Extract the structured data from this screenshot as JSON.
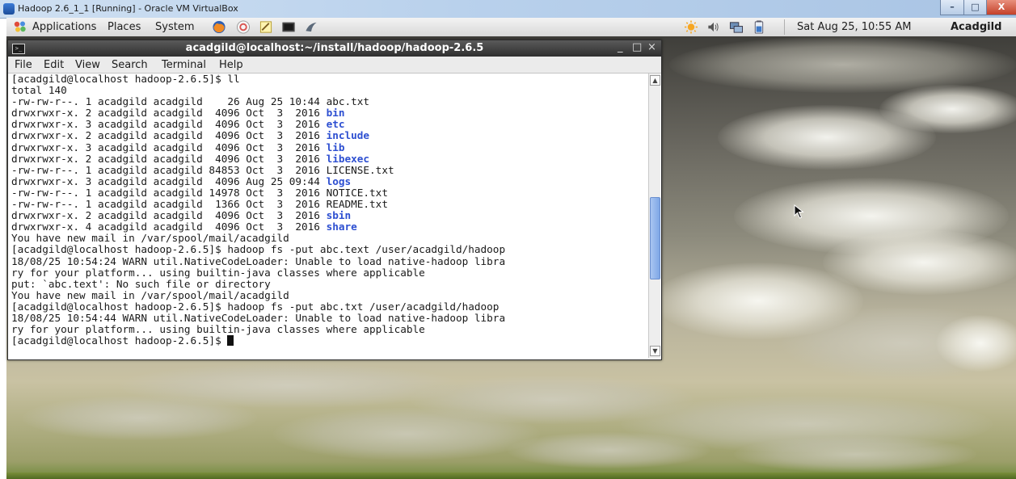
{
  "vbox": {
    "title": "Hadoop 2.6_1_1 [Running] - Oracle VM VirtualBox",
    "min": "–",
    "max": "□",
    "close": "X"
  },
  "panel": {
    "menus": [
      "Applications",
      "Places",
      "System"
    ],
    "clock": "Sat Aug 25, 10:55 AM",
    "user": "Acadgild"
  },
  "terminal": {
    "title": "acadgild@localhost:~/install/hadoop/hadoop-2.6.5",
    "controls": {
      "min": "_",
      "max": "□",
      "close": "×"
    },
    "menus": [
      "File",
      "Edit",
      "View",
      "Search",
      "Terminal",
      "Help"
    ],
    "lines": [
      {
        "t": "[acadgild@localhost hadoop-2.6.5]$ ll",
        "d": ""
      },
      {
        "t": "total 140",
        "d": ""
      },
      {
        "t": "-rw-rw-r--. 1 acadgild acadgild    26 Aug 25 10:44 ",
        "d": "",
        "f": "abc.txt"
      },
      {
        "t": "drwxrwxr-x. 2 acadgild acadgild  4096 Oct  3  2016 ",
        "d": "bin"
      },
      {
        "t": "drwxrwxr-x. 3 acadgild acadgild  4096 Oct  3  2016 ",
        "d": "etc"
      },
      {
        "t": "drwxrwxr-x. 2 acadgild acadgild  4096 Oct  3  2016 ",
        "d": "include"
      },
      {
        "t": "drwxrwxr-x. 3 acadgild acadgild  4096 Oct  3  2016 ",
        "d": "lib"
      },
      {
        "t": "drwxrwxr-x. 2 acadgild acadgild  4096 Oct  3  2016 ",
        "d": "libexec"
      },
      {
        "t": "-rw-rw-r--. 1 acadgild acadgild 84853 Oct  3  2016 ",
        "d": "",
        "f": "LICENSE.txt"
      },
      {
        "t": "drwxrwxr-x. 3 acadgild acadgild  4096 Aug 25 09:44 ",
        "d": "logs"
      },
      {
        "t": "-rw-rw-r--. 1 acadgild acadgild 14978 Oct  3  2016 ",
        "d": "",
        "f": "NOTICE.txt"
      },
      {
        "t": "-rw-rw-r--. 1 acadgild acadgild  1366 Oct  3  2016 ",
        "d": "",
        "f": "README.txt"
      },
      {
        "t": "drwxrwxr-x. 2 acadgild acadgild  4096 Oct  3  2016 ",
        "d": "sbin"
      },
      {
        "t": "drwxrwxr-x. 4 acadgild acadgild  4096 Oct  3  2016 ",
        "d": "share"
      },
      {
        "t": "You have new mail in /var/spool/mail/acadgild",
        "d": ""
      },
      {
        "t": "[acadgild@localhost hadoop-2.6.5]$ hadoop fs -put abc.text /user/acadgild/hadoop",
        "d": ""
      },
      {
        "t": "18/08/25 10:54:24 WARN util.NativeCodeLoader: Unable to load native-hadoop libra",
        "d": ""
      },
      {
        "t": "ry for your platform... using builtin-java classes where applicable",
        "d": ""
      },
      {
        "t": "put: `abc.text': No such file or directory",
        "d": ""
      },
      {
        "t": "You have new mail in /var/spool/mail/acadgild",
        "d": ""
      },
      {
        "t": "[acadgild@localhost hadoop-2.6.5]$ hadoop fs -put abc.txt /user/acadgild/hadoop",
        "d": ""
      },
      {
        "t": "18/08/25 10:54:44 WARN util.NativeCodeLoader: Unable to load native-hadoop libra",
        "d": ""
      },
      {
        "t": "ry for your platform... using builtin-java classes where applicable",
        "d": ""
      },
      {
        "t": "[acadgild@localhost hadoop-2.6.5]$ ",
        "d": "",
        "cursor": true
      }
    ],
    "scroll_position": 0.62
  },
  "colors": {
    "dir": "#2d4fd1",
    "panel": "#e6e6e6",
    "titlebar": "#3a3a3a"
  },
  "icons": [
    "virtualbox-icon",
    "applications-icon",
    "firefox-icon",
    "help-icon",
    "text-editor-icon",
    "terminal-launcher-icon",
    "wireshark-icon",
    "weather-icon",
    "volume-icon",
    "network-icon",
    "battery-icon",
    "terminal-icon",
    "mouse-cursor-icon"
  ]
}
